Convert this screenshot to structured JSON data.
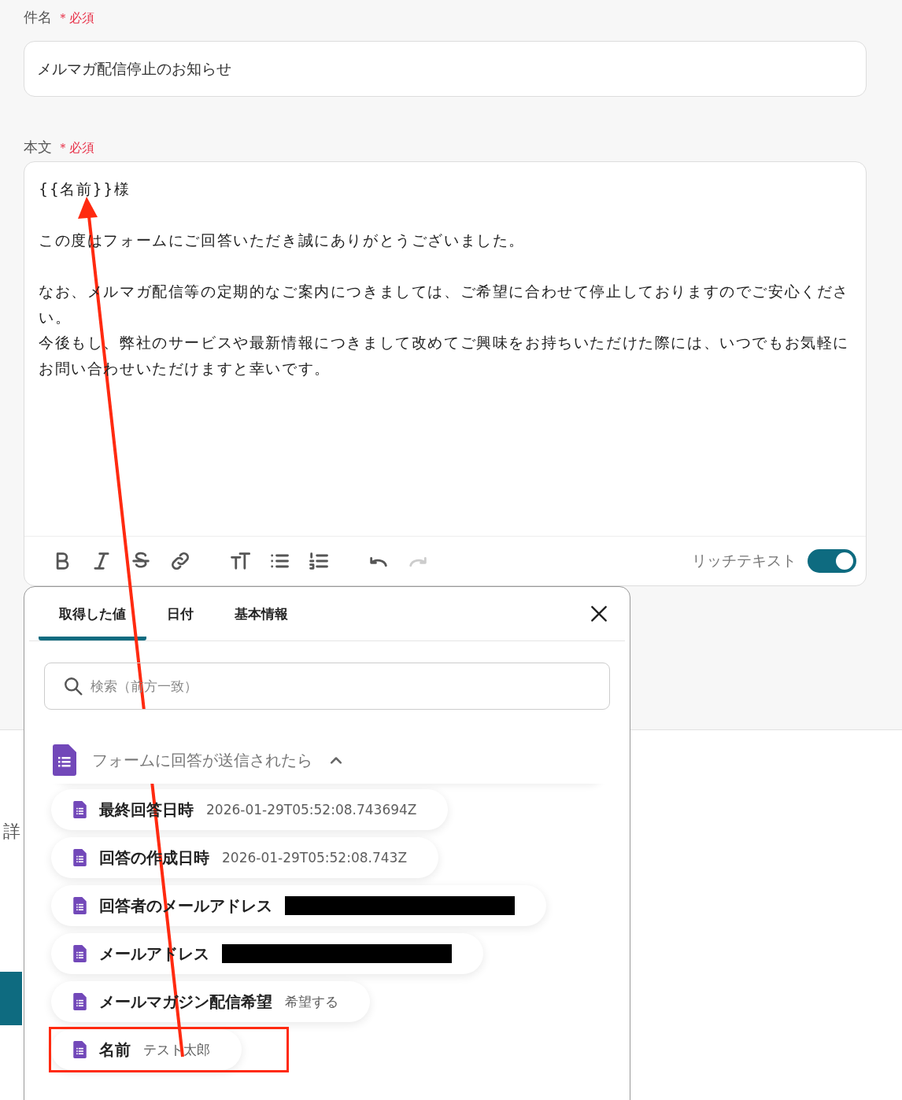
{
  "subject": {
    "label": "件名",
    "required": "＊必須",
    "value": "メルマガ配信停止のお知らせ"
  },
  "body": {
    "label": "本文",
    "required": "＊必須",
    "paragraphs": [
      [
        "{{名前}}様"
      ],
      [
        "この度はフォームにご回答いただき誠にありがとうございました。"
      ],
      [
        "なお、メルマガ配信等の定期的なご案内につきましては、ご希望に合わせて停止しておりますのでご安心ください。",
        "今後もし、弊社のサービスや最新情報につきまして改めてご興味をお持ちいただけた際には、いつでもお気軽にお問い合わせいただけますと幸いです。"
      ]
    ],
    "toolbar": [
      {
        "kind": "bold",
        "disabled": false
      },
      {
        "kind": "italic",
        "disabled": false
      },
      {
        "kind": "strike",
        "disabled": false
      },
      {
        "kind": "link",
        "disabled": false
      },
      {
        "kind": "textsize",
        "disabled": false
      },
      {
        "kind": "bullets",
        "disabled": false
      },
      {
        "kind": "numbers",
        "disabled": false
      },
      {
        "kind": "undo",
        "disabled": false
      },
      {
        "kind": "redo",
        "disabled": true
      }
    ],
    "richtext": {
      "label": "リッチテキスト",
      "on": true
    }
  },
  "section_label": "詳",
  "picker": {
    "tabs": [
      {
        "label": "取得した値",
        "selected": true
      },
      {
        "label": "日付",
        "selected": false
      },
      {
        "label": "基本情報",
        "selected": false
      }
    ],
    "search": {
      "placeholder": "検索（前方一致）"
    },
    "group": {
      "title": "フォームに回答が送信されたら",
      "expanded": true
    },
    "items": [
      {
        "label": "最終回答日時",
        "value": "2026-01-29T05:52:08.743694Z",
        "redacted": false,
        "highlighted": false
      },
      {
        "label": "回答の作成日時",
        "value": "2026-01-29T05:52:08.743Z",
        "redacted": false,
        "highlighted": false
      },
      {
        "label": "回答者のメールアドレス",
        "redacted": true,
        "highlighted": false
      },
      {
        "label": "メールアドレス",
        "redacted": true,
        "highlighted": false
      },
      {
        "label": "メールマガジン配信希望",
        "value": "希望する",
        "redacted": false,
        "highlighted": false
      },
      {
        "label": "名前",
        "value": "テスト太郎",
        "redacted": false,
        "highlighted": true
      }
    ]
  }
}
